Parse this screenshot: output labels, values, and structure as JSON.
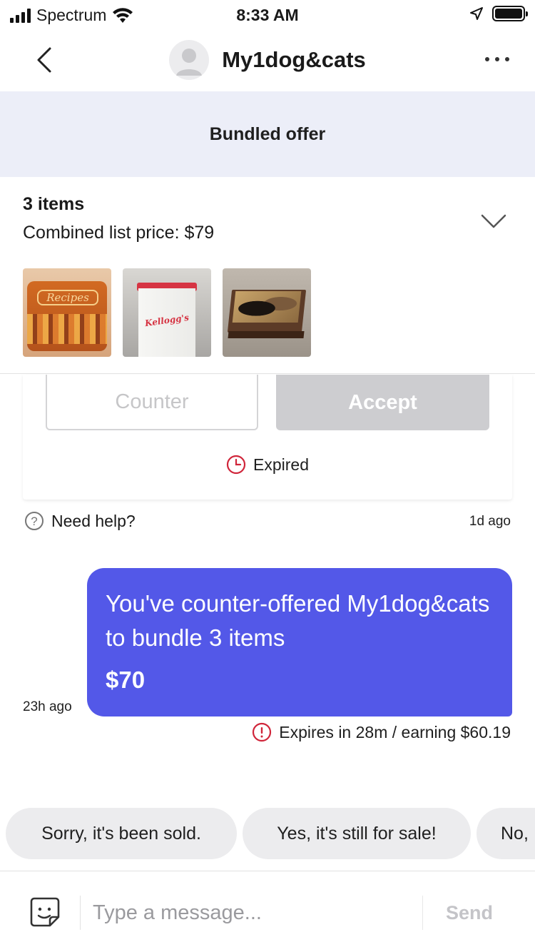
{
  "status_bar": {
    "carrier": "Spectrum",
    "time": "8:33 AM"
  },
  "header": {
    "title": "My1dog&cats",
    "icons": [
      "back-icon",
      "avatar",
      "more-icon"
    ]
  },
  "offer": {
    "banner": "Bundled offer",
    "items_count": "3 items",
    "combined_price": "Combined list price: $79",
    "thumbnails": [
      "recipe-tin-photo",
      "kelloggs-container-photo",
      "cat-box-photo"
    ],
    "thumb_texts": [
      "Recipes",
      "Kellogg's"
    ],
    "counter_label": "Counter",
    "accept_label": "Accept",
    "status": "Expired"
  },
  "help": {
    "label": "Need help?",
    "timestamp": "1d ago"
  },
  "message": {
    "text": "You've counter-offered My1dog&cats to bundle 3 items",
    "amount": "$70",
    "timestamp": "23h ago",
    "expires": "Expires in 28m / earning $60.19"
  },
  "quick_replies": [
    "Sorry, it's been sold.",
    "Yes, it's still for sale!",
    "No,"
  ],
  "composer": {
    "placeholder": "Type a message...",
    "send_label": "Send"
  },
  "colors": {
    "bubble": "#5358e8",
    "banner": "#eceef8",
    "alert": "#d0253a"
  }
}
